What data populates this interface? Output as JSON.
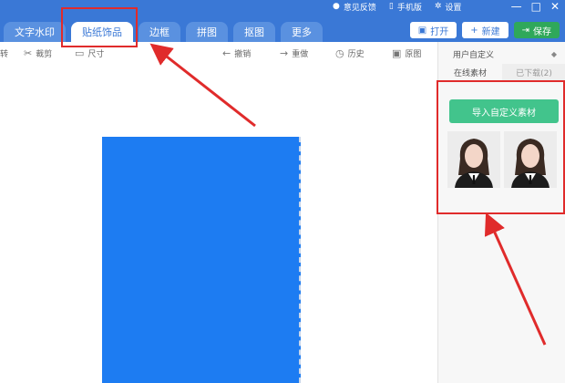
{
  "header": {
    "links": [
      {
        "icon": "feedback-icon",
        "label": "意见反馈"
      },
      {
        "icon": "phone-icon",
        "label": "手机版"
      },
      {
        "icon": "gear-icon",
        "label": "设置"
      }
    ],
    "tabs": [
      {
        "label": "文字水印",
        "active": false
      },
      {
        "label": "贴纸饰品",
        "active": true
      },
      {
        "label": "边框",
        "active": false
      },
      {
        "label": "拼图",
        "active": false
      },
      {
        "label": "抠图",
        "active": false
      },
      {
        "label": "更多",
        "active": false
      }
    ],
    "buttons": {
      "open": "打开",
      "new": "新建",
      "save": "保存"
    }
  },
  "toolbar": {
    "rotate": "转",
    "crop": "裁剪",
    "size": "尺寸",
    "undo": "撤销",
    "redo": "重做",
    "history": "历史",
    "original": "原图"
  },
  "side_panel": {
    "select_value": "用户自定义",
    "tabs": [
      "在线素材",
      "已下载(2)"
    ],
    "active_tab": 0,
    "import_button": "导入自定义素材",
    "thumbnail_count": 2
  },
  "colors": {
    "titlebar": "#3a78d6",
    "photo_background": "#1d7cf2",
    "import_button": "#42c48c",
    "annotation": "#e02b2b"
  }
}
